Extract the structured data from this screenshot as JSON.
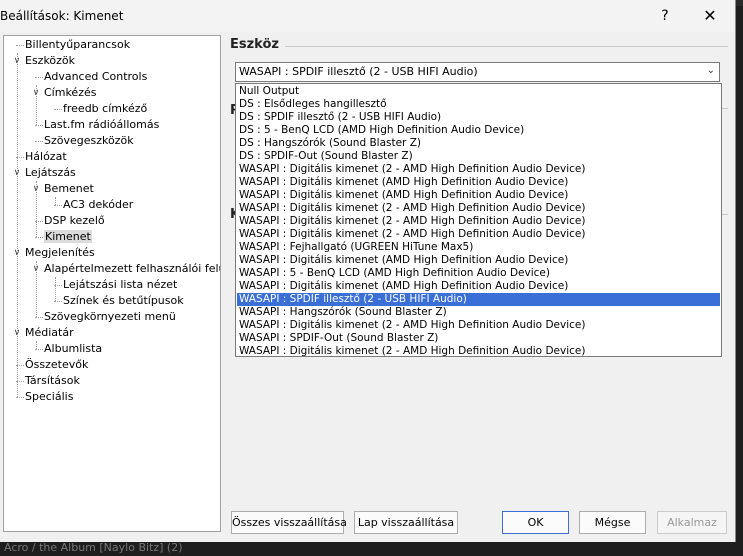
{
  "window": {
    "title": "Beállítások: Kimenet",
    "help_label": "?",
    "close_label": "✕"
  },
  "tree": {
    "items": [
      {
        "label": "Billentyűparancsok"
      },
      {
        "label": "Eszközök"
      },
      {
        "label": "Advanced Controls"
      },
      {
        "label": "Címkézés"
      },
      {
        "label": "freedb címkéző"
      },
      {
        "label": "Last.fm rádióállomás"
      },
      {
        "label": "Szövegeszközök"
      },
      {
        "label": "Hálózat"
      },
      {
        "label": "Lejátszás"
      },
      {
        "label": "Bemenet"
      },
      {
        "label": "AC3 dekóder"
      },
      {
        "label": "DSP kezelő"
      },
      {
        "label": "Kimenet"
      },
      {
        "label": "Megjelenítés"
      },
      {
        "label": "Alapértelmezett felhasználói felület"
      },
      {
        "label": "Lejátszási lista nézet"
      },
      {
        "label": "Színek és betűtípusok"
      },
      {
        "label": "Szövegkörnyezeti menü"
      },
      {
        "label": "Médiatár"
      },
      {
        "label": "Albumlista"
      },
      {
        "label": "Összetevők"
      },
      {
        "label": "Társítások"
      },
      {
        "label": "Speciális"
      }
    ]
  },
  "device": {
    "section_title": "Eszköz",
    "selected": "WASAPI : SPDIF illesztő (2 - USB HIFI Audio)",
    "options": [
      "Null Output",
      "DS : Elsődleges hangillesztő",
      "DS : SPDIF illesztő (2 - USB HIFI Audio)",
      "DS : 5 - BenQ LCD (AMD High Definition Audio Device)",
      "DS : Hangszórók (Sound Blaster Z)",
      "DS : SPDIF-Out (Sound Blaster Z)",
      "WASAPI : Digitális kimenet (2 - AMD High Definition Audio Device)",
      "WASAPI : Digitális kimenet (AMD High Definition Audio Device)",
      "WASAPI : Digitális kimenet (AMD High Definition Audio Device)",
      "WASAPI : Digitális kimenet (2 - AMD High Definition Audio Device)",
      "WASAPI : Digitális kimenet (2 - AMD High Definition Audio Device)",
      "WASAPI : Digitális kimenet (2 - AMD High Definition Audio Device)",
      "WASAPI : Fejhallgató (UGREEN HiTune Max5)",
      "WASAPI : Digitális kimenet (AMD High Definition Audio Device)",
      "WASAPI : 5 - BenQ LCD (AMD High Definition Audio Device)",
      "WASAPI : Digitális kimenet (AMD High Definition Audio Device)",
      "WASAPI : SPDIF illesztő (2 - USB HIFI Audio)",
      "WASAPI : Hangszórók (Sound Blaster Z)",
      "WASAPI : Digitális kimenet (2 - AMD High Definition Audio Device)",
      "WASAPI : SPDIF-Out (Sound Blaster Z)",
      "WASAPI : Digitális kimenet (2 - AMD High Definition Audio Device)"
    ],
    "selected_index": 16
  },
  "peek": {
    "letter1": "P",
    "letter2": "K"
  },
  "buttons": {
    "reset_all": "Összes visszaállítása",
    "reset_page": "Lap visszaállítása",
    "ok": "OK",
    "cancel": "Mégse",
    "apply": "Alkalmaz"
  },
  "background_text": "Acro / the Album [Naylo Bitz] (2)",
  "colors": {
    "selection": "#3a6fd8"
  }
}
